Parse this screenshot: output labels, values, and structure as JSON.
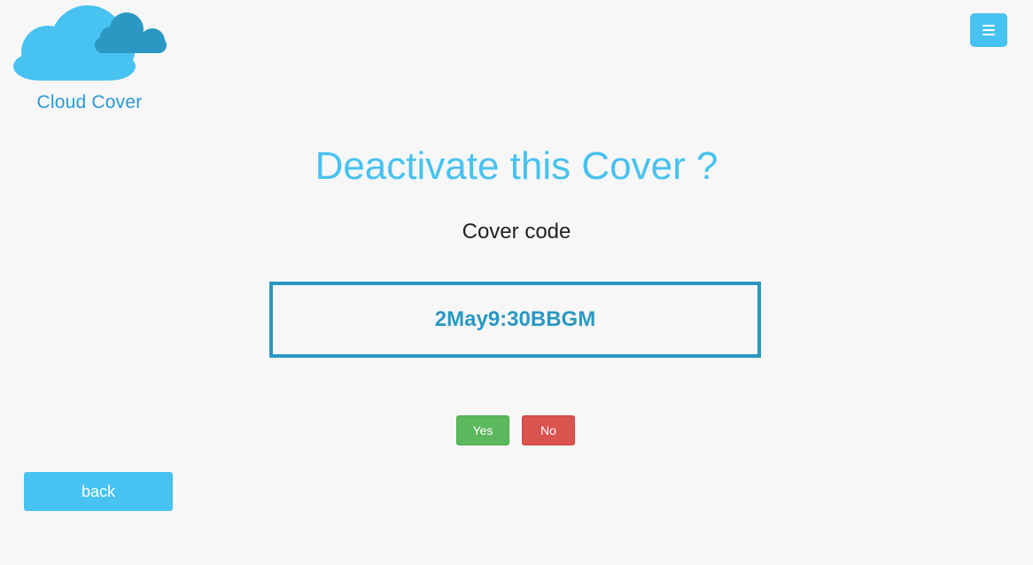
{
  "brand": {
    "name": "Cloud Cover",
    "logo_icon": "cloud-icon",
    "primary_color": "#47c2f1",
    "secondary_color": "#2b98c3"
  },
  "header": {
    "menu_icon": "hamburger-menu-icon"
  },
  "main": {
    "heading": "Deactivate this Cover ?",
    "code_label": "Cover code",
    "code_value": "2May9:30BBGM"
  },
  "actions": {
    "yes_label": "Yes",
    "no_label": "No",
    "back_label": "back",
    "yes_color": "#5cb85c",
    "no_color": "#d9534f"
  }
}
